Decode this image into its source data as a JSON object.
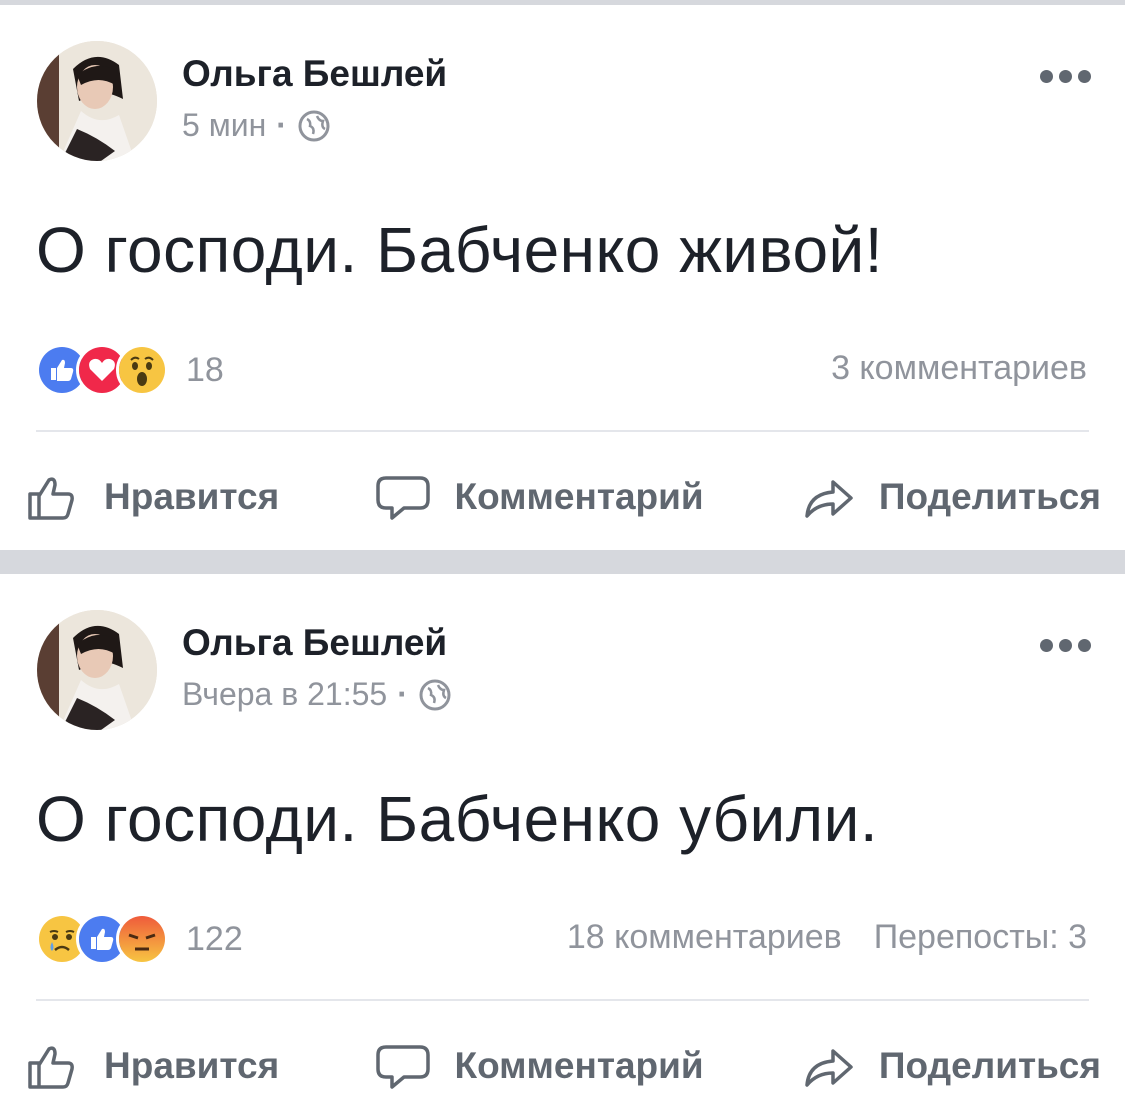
{
  "posts": [
    {
      "author": "Ольга Бешлей",
      "time": "5 мин",
      "text": "О господи. Бабченко живой!",
      "reactions": [
        "like",
        "love",
        "wow"
      ],
      "reaction_count": "18",
      "comments": "3 комментариев",
      "shares": ""
    },
    {
      "author": "Ольга Бешлей",
      "time": "Вчера в 21:55",
      "text": "О господи. Бабченко убили.",
      "reactions": [
        "sad",
        "like",
        "angry"
      ],
      "reaction_count": "122",
      "comments": "18 комментариев",
      "shares": "Перепосты: 3"
    }
  ],
  "actions": {
    "like": "Нравится",
    "comment": "Комментарий",
    "share": "Поделиться"
  },
  "colors": {
    "like": "#4c7cf0",
    "love": "#f0284a",
    "wow": "#f7c542",
    "angry": "#ef5b3b",
    "text_secondary": "#90949c"
  },
  "icons": {
    "privacy": "globe-icon",
    "menu": "more-options-icon"
  }
}
